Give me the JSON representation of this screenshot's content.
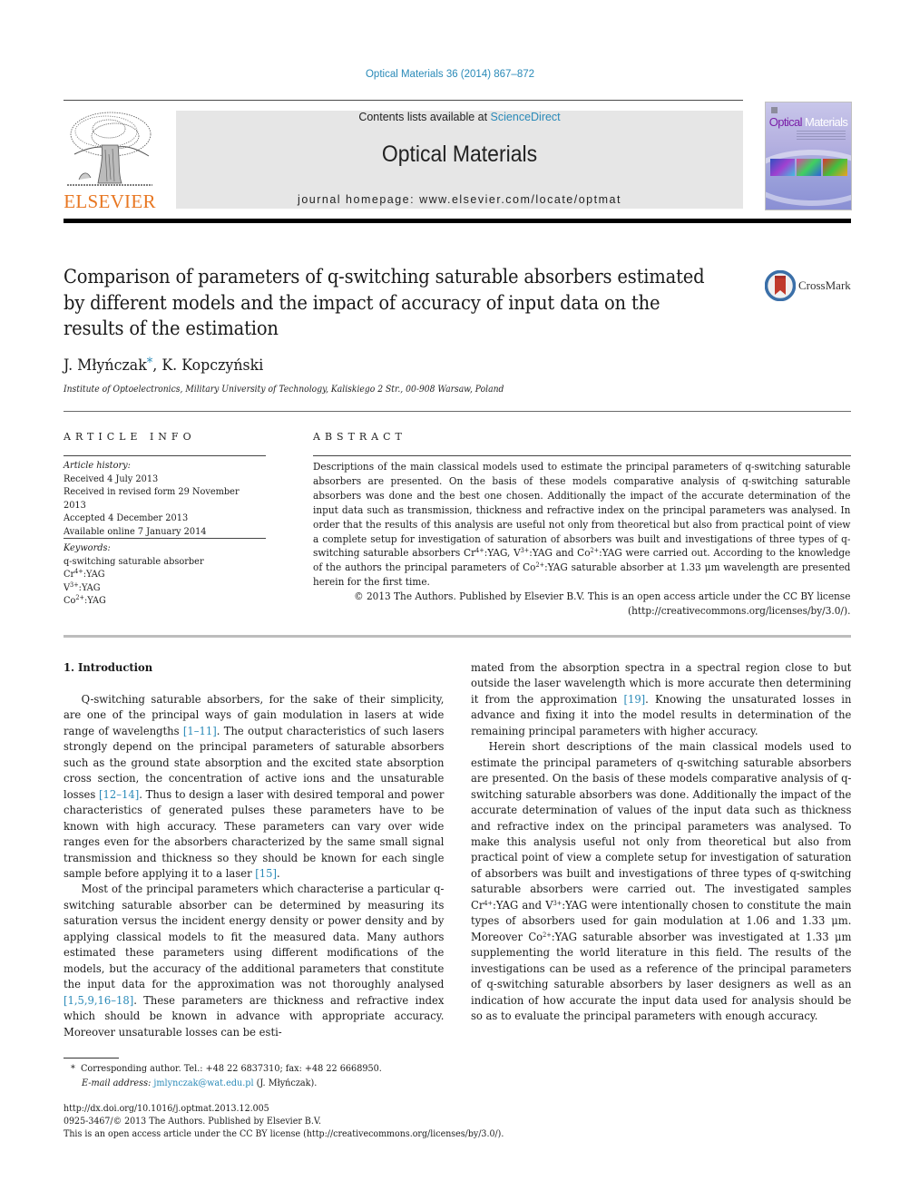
{
  "header": {
    "citation": "Optical Materials 36 (2014) 867–872",
    "contents_prefix": "Contents lists available at ",
    "contents_link": "ScienceDirect",
    "journal_title": "Optical Materials",
    "homepage_prefix": "journal homepage: ",
    "homepage_url": "www.elsevier.com/locate/optmat",
    "publisher_logo_text": "ELSEVIER",
    "cover_title_part1": "Optical",
    "cover_title_part2": "Materials",
    "crossmark_label": "CrossMark"
  },
  "colors": {
    "link": "#2a8ab8",
    "elsevier_orange": "#e87722",
    "banner_gray": "#e6e6e6",
    "cover_purple": "#7a1fa8"
  },
  "article": {
    "title": "Comparison of parameters of q-switching saturable absorbers estimated by different models and the impact of accuracy of input data on the results of the estimation",
    "author1": "J. Młyńczak",
    "author_star": "*",
    "author_sep": ", ",
    "author2": "K. Kopczyński",
    "affiliation": "Institute of Optoelectronics, Military University of Technology, Kaliskiego 2 Str., 00-908 Warsaw, Poland"
  },
  "article_info": {
    "heading": "ARTICLE INFO",
    "history_label": "Article history:",
    "history": [
      "Received 4 July 2013",
      "Received in revised form 29 November 2013",
      "Accepted 4 December 2013",
      "Available online 7 January 2014"
    ],
    "keywords_label": "Keywords:",
    "keywords": [
      {
        "base": "q-switching saturable absorber",
        "sup": "",
        "suffix": ""
      },
      {
        "base": "Cr",
        "sup": "4+",
        "suffix": ":YAG"
      },
      {
        "base": "V",
        "sup": "3+",
        "suffix": ":YAG"
      },
      {
        "base": "Co",
        "sup": "2+",
        "suffix": ":YAG"
      }
    ]
  },
  "abstract": {
    "heading": "ABSTRACT",
    "text_a": "Descriptions of the main classical models used to estimate the principal parameters of q-switching saturable absorbers are presented. On the basis of these models comparative analysis of q-switching saturable absorbers was done and the best one chosen. Additionally the impact of the accurate determination of the input data such as transmission, thickness and refractive index on the principal parameters was analysed. In order that the results of this analysis are useful not only from theoretical but also from practical point of view a complete setup for investigation of saturation of absorbers was built and investigations of three types of q-switching saturable absorbers Cr",
    "sup_a": "4+",
    "text_b": ":YAG, V",
    "sup_b": "3+",
    "text_c": ":YAG and Co",
    "sup_c": "2+",
    "text_d": ":YAG were carried out. According to the knowledge of the authors the principal parameters of Co",
    "sup_d": "2+",
    "text_e": ":YAG saturable absorber at 1.33 μm wavelength are presented herein for the first time.",
    "copyright": "© 2013 The Authors. Published by Elsevier B.V. This is an open access article under the CC BY license (http://creativecommons.org/licenses/by/3.0/)."
  },
  "body": {
    "section_heading": "1. Introduction",
    "left_p1_a": "Q-switching saturable absorbers, for the sake of their simplicity, are one of the principal ways of gain modulation in lasers at wide range of wavelengths ",
    "left_p1_ref1": "[1–11]",
    "left_p1_b": ". The output characteristics of such lasers strongly depend on the principal parameters of saturable absorbers such as the ground state absorption and the excited state absorption cross section, the concentration of active ions and the unsaturable losses ",
    "left_p1_ref2": "[12–14]",
    "left_p1_c": ". Thus to design a laser with desired temporal and power characteristics of generated pulses these parameters have to be known with high accuracy. These parameters can vary over wide ranges even for the absorbers characterized by the same small signal transmission and thickness so they should be known for each single sample before applying it to a laser ",
    "left_p1_ref3": "[15]",
    "left_p1_d": ".",
    "left_p2_a": "Most of the principal parameters which characterise a particular q-switching saturable absorber can be determined by measuring its saturation versus the incident energy density or power density and by applying classical models to fit the measured data. Many authors estimated these parameters using different modifications of the models, but the accuracy of the additional parameters that constitute the input data for the approximation was not thoroughly analysed ",
    "left_p2_ref": "[1,5,9,16–18]",
    "left_p2_b": ". These parameters are thickness and refractive index which should be known in advance with appropriate accuracy. Moreover unsaturable losses can be esti-",
    "right_p1_a": "mated from the absorption spectra in a spectral region close to but outside the laser wavelength which is more accurate then determining it from the approximation ",
    "right_p1_ref": "[19]",
    "right_p1_b": ". Knowing the unsaturated losses in advance and fixing it into the model results in determination of the remaining principal parameters with higher accuracy.",
    "right_p2_a": "Herein short descriptions of the main classical models used to estimate the principal parameters of q-switching saturable absorbers are presented. On the basis of these models comparative analysis of q-switching saturable absorbers was done. Additionally the impact of the accurate determination of values of the input data such as thickness and refractive index on the principal parameters was analysed. To make this analysis useful not only from theoretical but also from practical point of view a complete setup for investigation of saturation of absorbers was built and investigations of three types of q-switching saturable absorbers were carried out. The investigated samples Cr",
    "right_p2_sup1": "4+",
    "right_p2_b": ":YAG and V",
    "right_p2_sup2": "3+",
    "right_p2_c": ":YAG were intentionally chosen to constitute the main types of absorbers used for gain modulation at 1.06 and 1.33 μm. Moreover Co",
    "right_p2_sup3": "2+",
    "right_p2_d": ":YAG saturable absorber was investigated at 1.33 μm supplementing the world literature in this field. The results of the investigations can be used as a reference of the principal parameters of q-switching saturable absorbers by laser designers as well as an indication of how accurate the input data used for analysis should be so as to evaluate the principal parameters with enough accuracy."
  },
  "footnotes": {
    "star": "*",
    "corresponding": "Corresponding author. Tel.: +48 22 6837310; fax: +48 22 6668950.",
    "email_label": "E-mail address: ",
    "email": "jmlynczak@wat.edu.pl",
    "email_suffix": " (J. Młyńczak).",
    "doi": "http://dx.doi.org/10.1016/j.optmat.2013.12.005",
    "issn": "0925-3467/© 2013 The Authors. Published by Elsevier B.V.",
    "license": "This is an open access article under the CC BY license (http://creativecommons.org/licenses/by/3.0/)."
  }
}
